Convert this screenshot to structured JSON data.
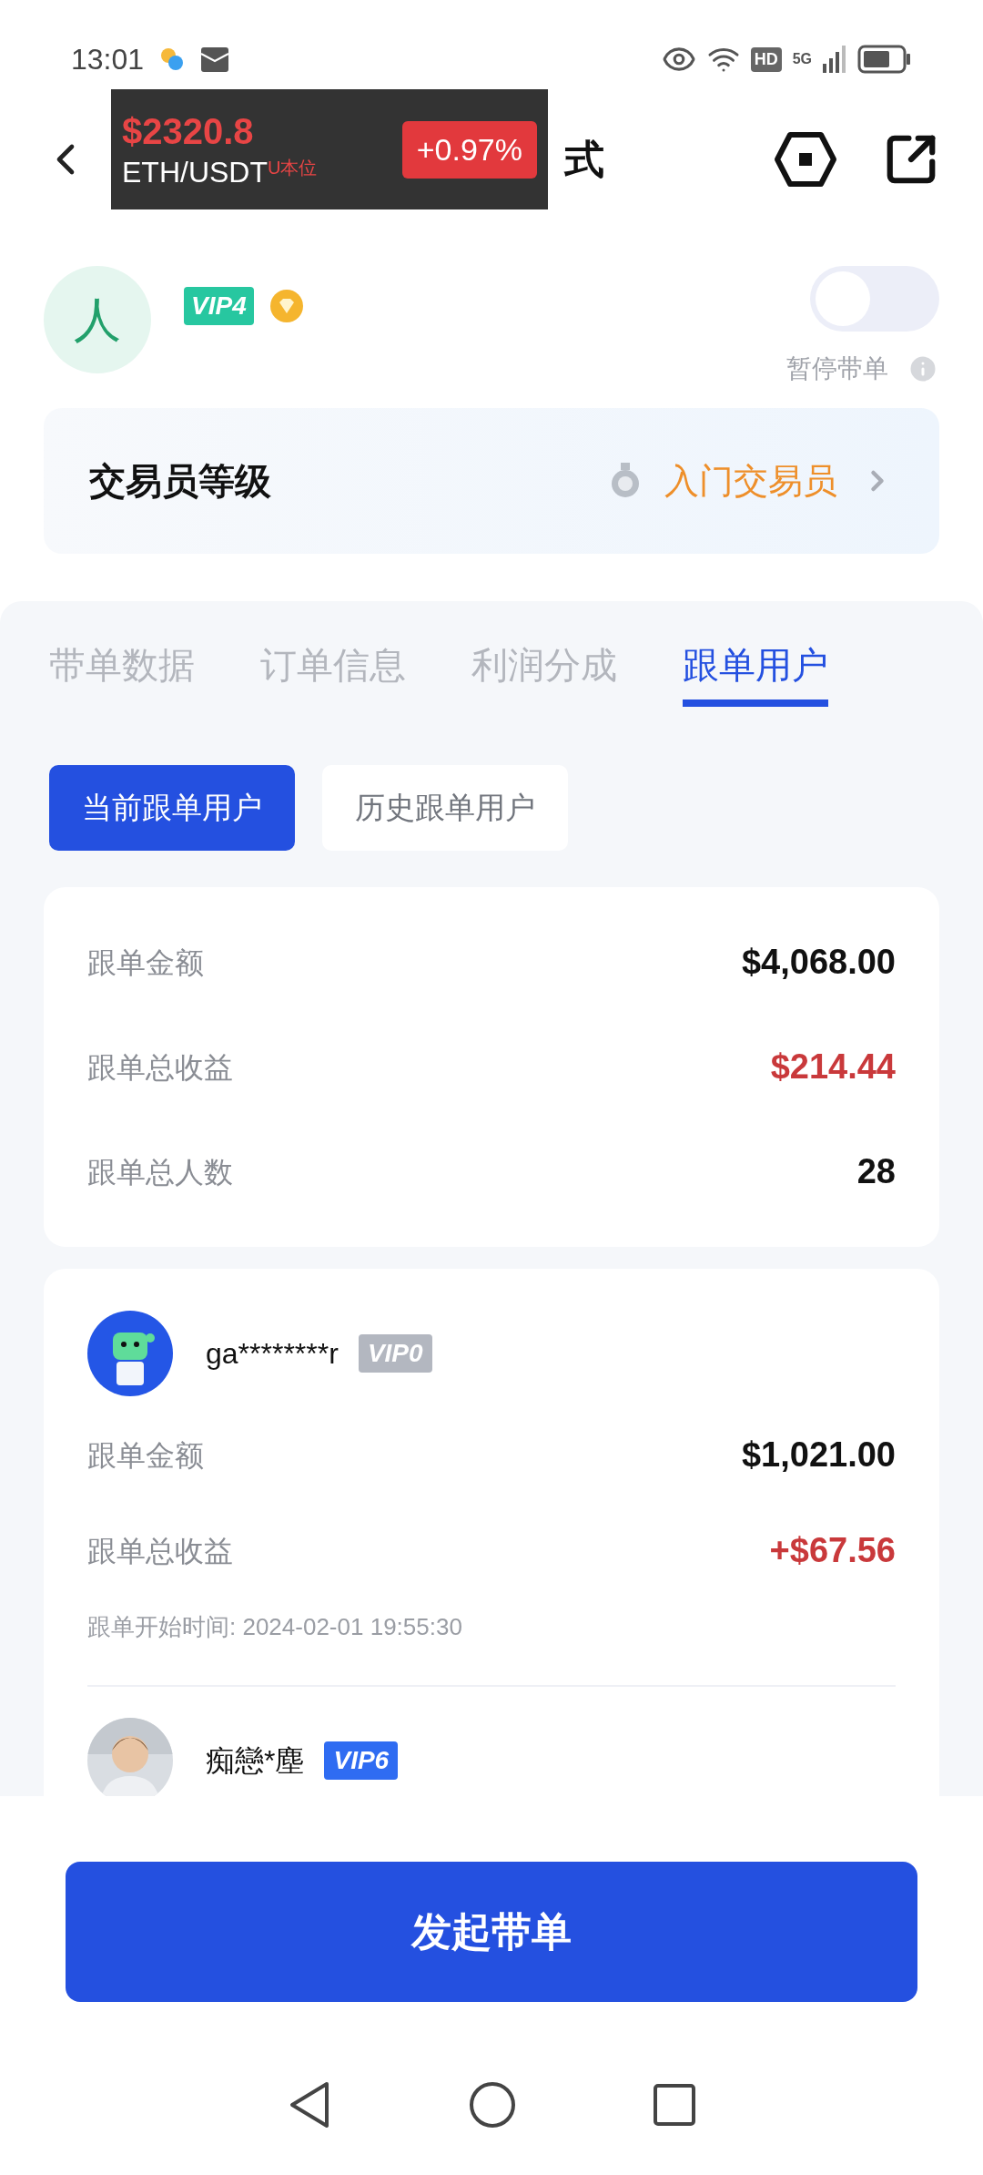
{
  "status_bar": {
    "time": "13:01",
    "hd": "HD",
    "network": "5G"
  },
  "header": {
    "title": "式"
  },
  "price_widget": {
    "price": "$2320.8",
    "pair": "ETH/USDT",
    "market": "U本位",
    "change": "+0.97%"
  },
  "profile": {
    "avatar_text": "人",
    "vip": "VIP4",
    "pause_toggle": {
      "label": "暂停带单",
      "on": false
    }
  },
  "trader_level": {
    "label": "交易员等级",
    "value": "入门交易员"
  },
  "tabs": [
    {
      "label": "带单数据",
      "selected": false
    },
    {
      "label": "订单信息",
      "selected": false
    },
    {
      "label": "利润分成",
      "selected": false
    },
    {
      "label": "跟单用户",
      "selected": true
    }
  ],
  "segments": [
    {
      "label": "当前跟单用户",
      "selected": true
    },
    {
      "label": "历史跟单用户",
      "selected": false
    }
  ],
  "summary": {
    "rows": [
      {
        "label": "跟单金额",
        "value": "$4,068.00",
        "kind": "neutral"
      },
      {
        "label": "跟单总收益",
        "value": "$214.44",
        "kind": "profit"
      },
      {
        "label": "跟单总人数",
        "value": "28",
        "kind": "neutral"
      }
    ]
  },
  "followers": [
    {
      "kind": "robot",
      "name": "ga********r",
      "vip": "VIP0",
      "color": "#b3b7c0",
      "rows": [
        {
          "label": "跟单金额",
          "value": "$1,021.00",
          "kind": "neutral"
        },
        {
          "label": "跟单总收益",
          "value": "+$67.56",
          "kind": "profit"
        }
      ],
      "start_time": "跟单开始时间: 2024-02-01 19:55:30"
    },
    {
      "kind": "picture",
      "name": "痴戀*塵",
      "vip": "VIP6",
      "color": "#2f6cf2"
    }
  ],
  "action_button": {
    "label": "发起带单"
  }
}
